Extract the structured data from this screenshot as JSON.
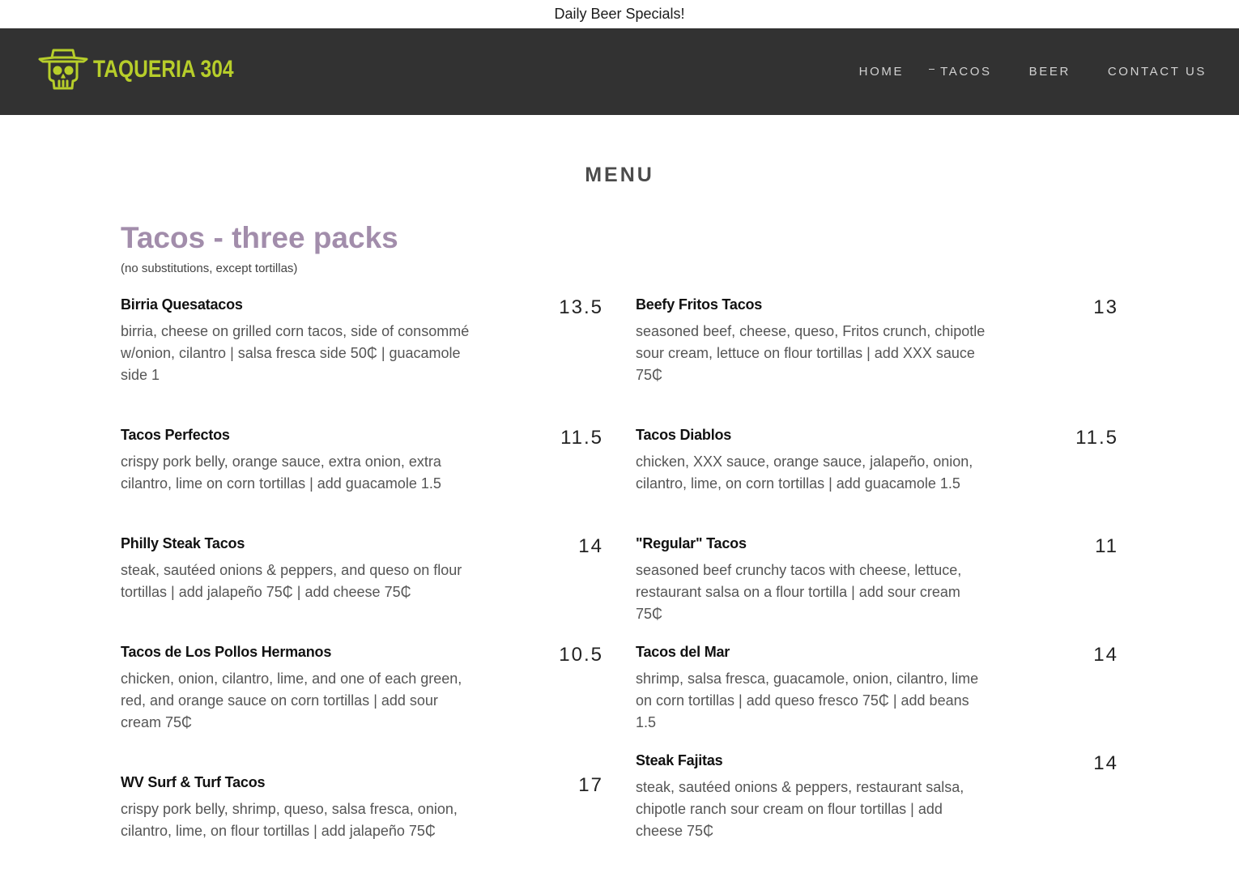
{
  "announcement": "Daily Beer Specials!",
  "brand": {
    "name": "TAQUERIA 304",
    "logo_icon": "skull-sombrero-icon",
    "accent": "#b7ce2a"
  },
  "nav": {
    "home": "HOME",
    "tacos": "TACOS",
    "beer": "BEER",
    "contact": "CONTACT US"
  },
  "menu": {
    "title": "MENU",
    "section": {
      "title": "Tacos - three packs",
      "subtitle": "(no substitutions, except tortillas)"
    },
    "left_items": [
      {
        "name": "Birria Quesatacos",
        "price": "13.5",
        "description": "birria, cheese on grilled corn tacos, side of consommé w/onion, cilantro | salsa fresca side 50₵ | guacamole side 1"
      },
      {
        "name": "Tacos Perfectos",
        "price": "11.5",
        "description": "crispy pork belly, orange sauce, extra onion, extra cilantro, lime on corn tortillas | add guacamole 1.5"
      },
      {
        "name": "Philly Steak Tacos",
        "price": "14",
        "description": "steak, sautéed onions & peppers, and queso on flour tortillas | add jalapeño 75₵ | add cheese 75₵"
      },
      {
        "name": "Tacos de Los Pollos Hermanos",
        "price": "10.5",
        "description": "chicken, onion, cilantro, lime, and one of each green, red, and orange sauce on corn tortillas | add sour cream 75₵"
      },
      {
        "name": "WV Surf & Turf Tacos",
        "price": "17",
        "description": "crispy pork belly, shrimp, queso, salsa fresca, onion, cilantro, lime, on flour tortillas | add jalapeño 75₵"
      }
    ],
    "right_items": [
      {
        "name": "Beefy Fritos Tacos",
        "price": "13",
        "description": "seasoned beef, cheese, queso, Fritos crunch, chipotle sour cream, lettuce on flour tortillas | add XXX sauce 75₵"
      },
      {
        "name": "Tacos Diablos",
        "price": "11.5",
        "description": "chicken, XXX sauce, orange sauce, jalapeño, onion, cilantro, lime, on corn tortillas | add guacamole 1.5"
      },
      {
        "name": "\"Regular\" Tacos",
        "price": "11",
        "description": "seasoned beef crunchy tacos with cheese, lettuce, restaurant salsa on a flour tortilla | add sour cream 75₵"
      },
      {
        "name": "Tacos del Mar",
        "price": "14",
        "description": "shrimp, salsa fresca, guacamole, onion, cilantro, lime on corn tortillas | add queso fresco 75₵ | add beans 1.5"
      },
      {
        "name": "Steak Fajitas",
        "price": "14",
        "description": "steak, sautéed onions & peppers, restaurant salsa, chipotle ranch sour cream on flour tortillas | add cheese 75₵"
      }
    ]
  }
}
